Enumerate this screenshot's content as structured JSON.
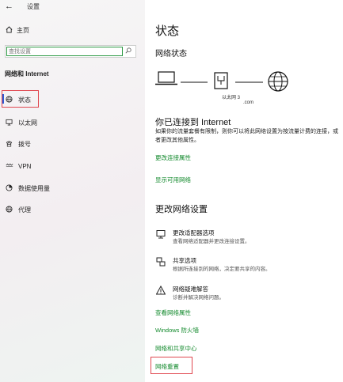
{
  "app": {
    "title": "设置"
  },
  "sidebar": {
    "home_label": "主页",
    "search": {
      "placeholder": "查找设置"
    },
    "section_title": "网络和 Internet",
    "items": [
      {
        "label": "状态",
        "icon": "globe-status-icon",
        "selected": true
      },
      {
        "label": "以太网",
        "icon": "ethernet-icon"
      },
      {
        "label": "拨号",
        "icon": "dialup-icon"
      },
      {
        "label": "VPN",
        "icon": "vpn-icon"
      },
      {
        "label": "数据使用量",
        "icon": "data-usage-icon"
      },
      {
        "label": "代理",
        "icon": "proxy-globe-icon"
      }
    ]
  },
  "main": {
    "title": "状态",
    "network_status": "网络状态",
    "diagram": {
      "adapter_label": "以太网 3",
      "domain_label": ".com"
    },
    "connected_title": "你已连接到 Internet",
    "connected_desc": "如果你的流量套餐有限制，则你可以将此网络设置为按流量计费的连接，或者更改其他属性。",
    "links": {
      "change_connection": "更改连接属性",
      "show_networks": "显示可用网络"
    },
    "change_settings_title": "更改网络设置",
    "options": [
      {
        "title": "更改适配器选项",
        "desc": "查看网络适配器并更改连接设置。",
        "icon": "adapter-icon"
      },
      {
        "title": "共享选项",
        "desc": "根据所连接到的网络，决定要共享的内容。",
        "icon": "sharing-icon"
      },
      {
        "title": "网络疑难解答",
        "desc": "诊断并解决网络问题。",
        "icon": "warning-icon"
      }
    ],
    "bottom_links": {
      "view_properties": "查看网络属性",
      "firewall": "Windows 防火墙",
      "sharing_center": "网络和共享中心",
      "reset": "网络重置"
    }
  },
  "colors": {
    "link": "#138a2d",
    "highlight": "#e0474f",
    "accent": "#2b5cd9"
  }
}
